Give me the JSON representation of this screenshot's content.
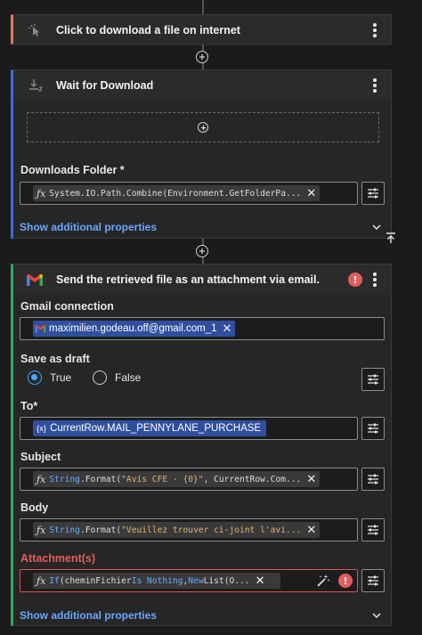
{
  "steps": {
    "download_click": {
      "title": "Click to download a file on internet"
    },
    "wait_download": {
      "title": "Wait for Download",
      "downloads_folder": {
        "label": "Downloads Folder *",
        "value": "System.IO.Path.Combine(Environment.GetFolderPa..."
      },
      "show_more": "Show additional properties"
    },
    "send_email": {
      "title": "Send the retrieved file as an attachment via email.",
      "gmail_connection": {
        "label": "Gmail connection",
        "value": "maximilien.godeau.off@gmail.com_1"
      },
      "save_as_draft": {
        "label": "Save as draft",
        "true_label": "True",
        "false_label": "False",
        "selected": "True"
      },
      "to": {
        "label": "To*",
        "value": "CurrentRow.MAIL_PENNYLANE_PURCHASE",
        "prefix": "{x}"
      },
      "subject": {
        "label": "Subject",
        "fn": "String",
        "rest": ".Format(",
        "str": "\"Avis CFE - {0}\"",
        "tail": ", CurrentRow.Com..."
      },
      "body": {
        "label": "Body",
        "fn": "String",
        "rest": ".Format(",
        "str": "\"Veuillez trouver ci-joint l'avi..."
      },
      "attachments": {
        "label": "Attachment(s)",
        "kw_if": "If",
        "p1": "(cheminFichier ",
        "kw_is": "Is Nothing",
        "p2": ", ",
        "kw_new": "New",
        "p3": " List(O..."
      },
      "show_more": "Show additional properties"
    }
  },
  "colors": {
    "accent_blue": "#6aa7ff",
    "error_red": "#e35d5d",
    "step_orange": "#e07a55",
    "step_blue": "#3b6fd6",
    "step_green": "#3fa35f"
  }
}
